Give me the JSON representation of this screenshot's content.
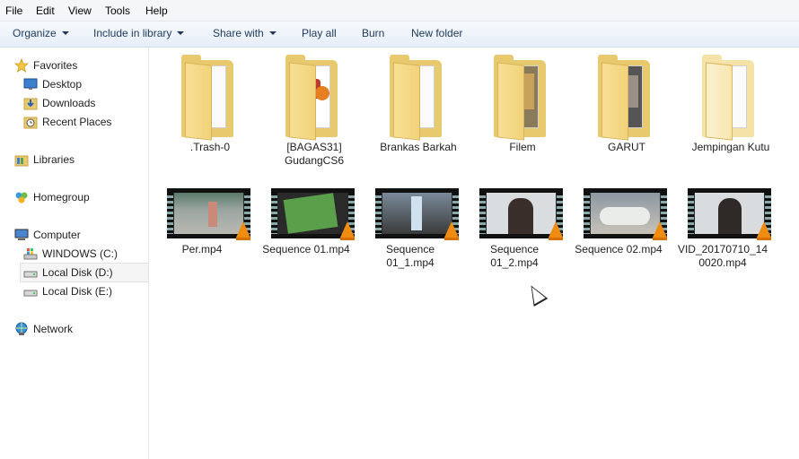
{
  "menu": [
    "File",
    "Edit",
    "View",
    "Tools",
    "Help"
  ],
  "toolbar": {
    "organize": "Organize",
    "include_in_library": "Include in library",
    "share_with": "Share with",
    "play_all": "Play all",
    "burn": "Burn",
    "new_folder": "New folder"
  },
  "nav": {
    "favorites": "Favorites",
    "desktop": "Desktop",
    "downloads": "Downloads",
    "recent_places": "Recent Places",
    "libraries": "Libraries",
    "homegroup": "Homegroup",
    "computer": "Computer",
    "drive_c": "WINDOWS (C:)",
    "drive_d": "Local Disk (D:)",
    "drive_e": "Local Disk (E:)",
    "network": "Network"
  },
  "folders": [
    {
      "line1": ".Trash-0",
      "line2": ""
    },
    {
      "line1": "[BAGAS31]",
      "line2": "GudangCS6"
    },
    {
      "line1": "Brankas Barkah",
      "line2": ""
    },
    {
      "line1": "Filem",
      "line2": ""
    },
    {
      "line1": "GARUT",
      "line2": ""
    },
    {
      "line1": "Jempingan Kutu",
      "line2": ""
    }
  ],
  "videos": [
    {
      "line1": "Per.mp4",
      "line2": ""
    },
    {
      "line1": "Sequence 01.mp4",
      "line2": ""
    },
    {
      "line1": "Sequence",
      "line2": "01_1.mp4"
    },
    {
      "line1": "Sequence",
      "line2": "01_2.mp4"
    },
    {
      "line1": "Sequence 02.mp4",
      "line2": ""
    },
    {
      "line1": "VID_20170710_14",
      "line2": "0020.mp4"
    }
  ],
  "colors": {
    "folder": "#e9c96d",
    "vlc_cone": "#f08c10",
    "toolbar_text": "#1e395b",
    "selected_bg": "#f5f5f5"
  }
}
